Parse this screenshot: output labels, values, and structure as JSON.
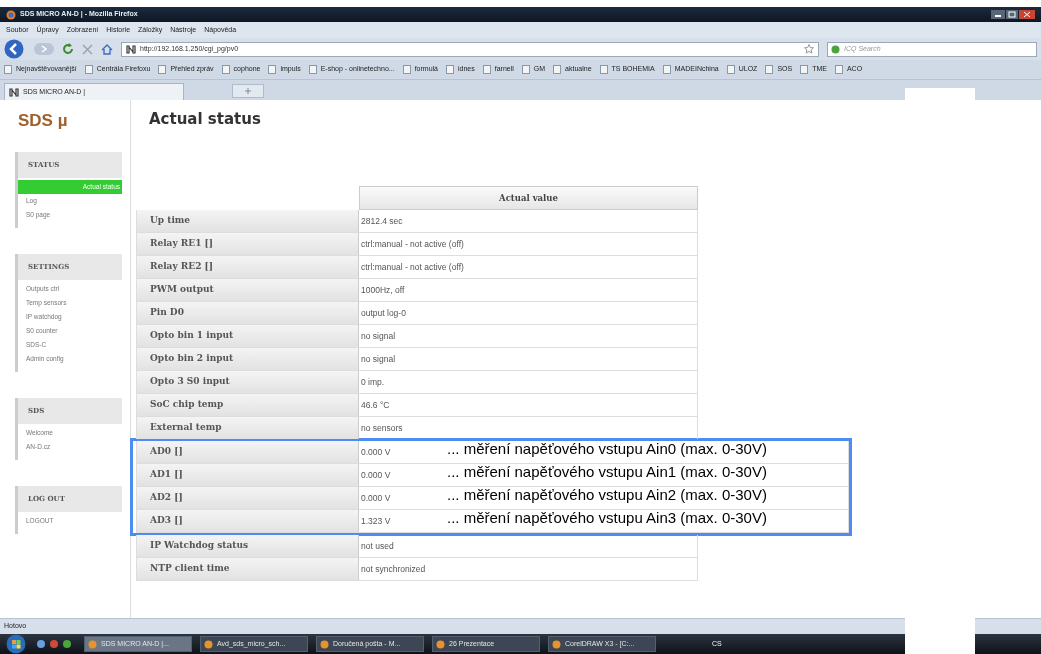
{
  "window": {
    "title": "SDS MICRO AN-D | - Mozilla Firefox"
  },
  "menu": [
    "Soubor",
    "Úpravy",
    "Zobrazení",
    "Historie",
    "Záložky",
    "Nástroje",
    "Nápověda"
  ],
  "address_bar": {
    "url": "http://192.168.1.250/cgi_pg/pv0"
  },
  "search": {
    "placeholder": "ICQ Search"
  },
  "bookmarks": [
    {
      "label": "Nejnavštěvovanější"
    },
    {
      "label": "Centrála Firefoxu"
    },
    {
      "label": "Přehled zpráv"
    },
    {
      "label": "cophone"
    },
    {
      "label": "impuls"
    },
    {
      "label": "E-shop - onlinetechno..."
    },
    {
      "label": "formulá"
    },
    {
      "label": "idnes"
    },
    {
      "label": "farnell"
    },
    {
      "label": "GM"
    },
    {
      "label": "aktualne"
    },
    {
      "label": "TS BOHEMIA"
    },
    {
      "label": "MADEINchina"
    },
    {
      "label": "ULOZ"
    },
    {
      "label": "SOS"
    },
    {
      "label": "TME"
    },
    {
      "label": "ACO"
    }
  ],
  "tabs": [
    {
      "label": "SDS MICRO AN-D |",
      "selected": true
    }
  ],
  "sidebar": {
    "logo": "SDS µ",
    "sections": [
      {
        "title": "STATUS",
        "items": [
          {
            "label": "Actual status",
            "selected": true
          },
          {
            "label": "Log",
            "selected": false
          },
          {
            "label": "S0 page",
            "selected": false
          }
        ]
      },
      {
        "title": "SETTINGS",
        "items": [
          {
            "label": "Outputs ctrl",
            "selected": false
          },
          {
            "label": "Temp sensors",
            "selected": false
          },
          {
            "label": "IP watchdog",
            "selected": false
          },
          {
            "label": "S0 counter",
            "selected": false
          },
          {
            "label": "SDS-C",
            "selected": false
          },
          {
            "label": "Admin config",
            "selected": false
          }
        ]
      },
      {
        "title": "SDS",
        "items": [
          {
            "label": "Welcome",
            "selected": false
          },
          {
            "label": "AN-D.cz",
            "selected": false
          }
        ]
      },
      {
        "title": "LOG OUT",
        "items": [
          {
            "label": "LOGOUT",
            "selected": false
          }
        ]
      }
    ]
  },
  "page": {
    "heading": "Actual status",
    "table": {
      "columns": [
        "Actual value"
      ],
      "rows": [
        {
          "label": "Up time",
          "value": "2812.4 sec"
        },
        {
          "label": "Relay RE1 []",
          "value": "ctrl:manual - not active (off)"
        },
        {
          "label": "Relay RE2 []",
          "value": "ctrl:manual - not active (off)"
        },
        {
          "label": "PWM output",
          "value": "1000Hz, off"
        },
        {
          "label": "Pin D0",
          "value": "output log-0"
        },
        {
          "label": "Opto bin 1 input",
          "value": "no signal"
        },
        {
          "label": "Opto bin 2 input",
          "value": "no signal"
        },
        {
          "label": "Opto 3 S0 input",
          "value": "0 imp."
        },
        {
          "label": "SoC chip temp",
          "value": "46.6 °C"
        },
        {
          "label": "External temp",
          "value": "no sensors"
        },
        {
          "label": "AD0 []",
          "value": "0.000 V",
          "note": "... měření napěťového vstupu Ain0  (max. 0-30V)"
        },
        {
          "label": "AD1 []",
          "value": "0.000 V",
          "note": "... měření napěťového vstupu Ain1  (max. 0-30V)"
        },
        {
          "label": "AD2 []",
          "value": "0.000 V",
          "note": "... měření napěťového vstupu Ain2  (max. 0-30V)"
        },
        {
          "label": "AD3 []",
          "value": "1.323 V",
          "note": "... měření napěťového vstupu Ain3  (max. 0-30V)"
        },
        {
          "label": "IP Watchdog status",
          "value": "not used"
        },
        {
          "label": "NTP client time",
          "value": "not synchronized"
        }
      ]
    }
  },
  "status_bar": "Hotovo",
  "taskbar": {
    "items": [
      {
        "label": "SDS MICRO AN-D |...",
        "selected": true
      },
      {
        "label": "Avd_sds_micro_sch...",
        "selected": false
      },
      {
        "label": "Doručená pošta - M...",
        "selected": false
      },
      {
        "label": "26 Prezentace",
        "selected": false
      },
      {
        "label": "CorelDRAW X3 - [C:...",
        "selected": false
      }
    ],
    "language": "CS"
  }
}
